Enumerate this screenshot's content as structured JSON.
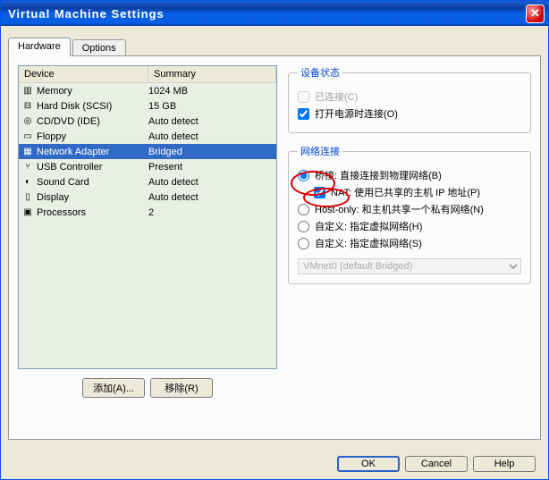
{
  "window": {
    "title": "Virtual Machine Settings"
  },
  "tabs": {
    "hardware": "Hardware",
    "options": "Options"
  },
  "list": {
    "h_dev": "Device",
    "h_sum": "Summary",
    "rows": [
      {
        "icon": "▥",
        "label": "Memory",
        "summary": "1024 MB"
      },
      {
        "icon": "⊟",
        "label": "Hard Disk (SCSI)",
        "summary": "15 GB"
      },
      {
        "icon": "◎",
        "label": "CD/DVD (IDE)",
        "summary": "Auto detect"
      },
      {
        "icon": "▭",
        "label": "Floppy",
        "summary": "Auto detect"
      },
      {
        "icon": "▦",
        "label": "Network Adapter",
        "summary": "Bridged"
      },
      {
        "icon": "⑂",
        "label": "USB Controller",
        "summary": "Present"
      },
      {
        "icon": "◐",
        "label": "Sound Card",
        "summary": "Auto detect"
      },
      {
        "icon": "▯",
        "label": "Display",
        "summary": "Auto detect"
      },
      {
        "icon": "▣",
        "label": "Processors",
        "summary": "2"
      }
    ],
    "selected": 4
  },
  "buttons": {
    "add": "添加(A)...",
    "remove": "移除(R)",
    "ok": "OK",
    "cancel": "Cancel",
    "help": "Help"
  },
  "status": {
    "legend": "设备状态",
    "connected": "已连接(C)",
    "connect_at_power": "打开电源时连接(O)"
  },
  "net": {
    "legend": "网络连接",
    "bridged": "桥接: 直接连接到物理网络(B)",
    "nat": "NAT: 使用已共享的主机 IP 地址(P)",
    "hostonly": "Host-only: 和主机共享一个私有网络(N)",
    "custom1": "自定义: 指定虚拟网络(H)",
    "custom2": "自定义: 指定虚拟网络(S)",
    "vmnet": "VMnet0 (default Bridged)"
  }
}
